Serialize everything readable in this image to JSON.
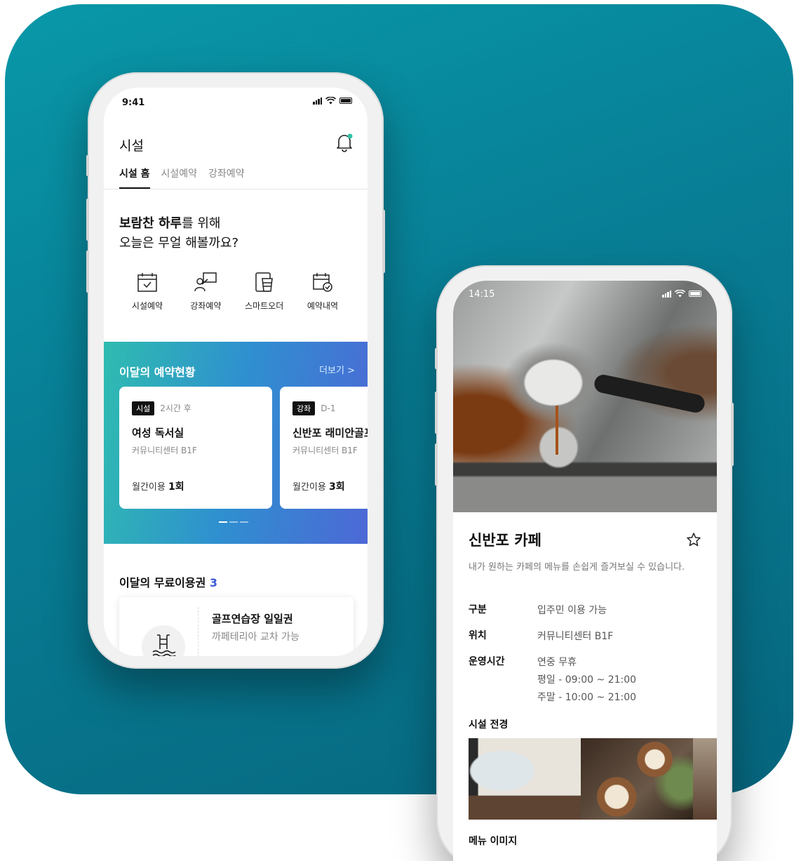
{
  "screen1": {
    "status_time": "9:41",
    "title": "시설",
    "tabs": [
      "시설 홈",
      "시설예약",
      "강좌예약"
    ],
    "greeting_bold": "보람찬 하루",
    "greeting_rest": "를 위해",
    "greeting_line2": "오늘은 무얼 해볼까요?",
    "quick_menu": [
      "시설예약",
      "강좌예약",
      "스마트오더",
      "예약내역"
    ],
    "monthly_title": "이달의 예약현황",
    "more_label": "더보기 >",
    "reservations": [
      {
        "badge": "시설",
        "when": "2시간 후",
        "name": "여성 독서실",
        "location": "커뮤니티센터 B1F",
        "usage_prefix": "월간이용 ",
        "usage_count": "1회"
      },
      {
        "badge": "강좌",
        "when": "D-1",
        "name": "신반포 래미안골프",
        "location": "커뮤니티센터 B1F",
        "usage_prefix": "월간이용 ",
        "usage_count": "3회"
      }
    ],
    "free_title": "이달의 무료이용권 ",
    "free_count": "3",
    "ticket_name": "골프연습장 일일권",
    "ticket_sub": "까페테리아 교차 가능"
  },
  "screen2": {
    "status_time": "14:15",
    "title": "신반포 카페",
    "description": "내가 원하는 카페의 메뉴를 손쉽게 즐겨보실 수 있습니다.",
    "info": [
      {
        "key": "구분",
        "values": [
          "입주민 이용 가능"
        ]
      },
      {
        "key": "위치",
        "values": [
          "커뮤니티센터 B1F"
        ]
      },
      {
        "key": "운영시간",
        "values": [
          "연중 무휴",
          "평일 - 09:00 ~ 21:00",
          "주말 - 10:00 ~ 21:00"
        ]
      }
    ],
    "gallery_title": "시설 전경",
    "menu_title": "메뉴 이미지"
  },
  "colors": {
    "accent": "#3b5bd6",
    "panel": "#087f96",
    "notify_dot": "#2fc2a6"
  },
  "icons": [
    "bell-icon",
    "calendar-check-icon",
    "lecture-icon",
    "smart-order-icon",
    "reservation-history-icon",
    "swimming-pool-icon",
    "star-icon"
  ]
}
